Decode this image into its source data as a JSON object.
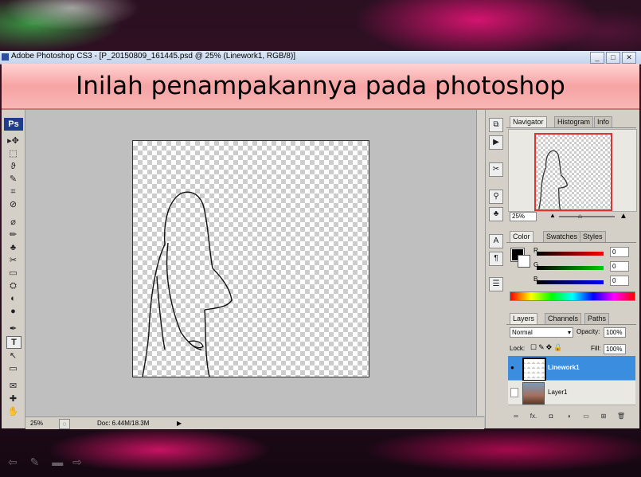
{
  "window": {
    "title": "Adobe Photoshop CS3 - [P_20150809_161445.psd @ 25% (Linework1, RGB/8)]",
    "buttons": [
      "_",
      "□",
      "✕"
    ]
  },
  "banner": {
    "text": "Inilah penampakannya pada photoshop"
  },
  "toolbox": {
    "logo": "Ps",
    "tools": [
      "▸✥",
      "⬚",
      "ϑ",
      "✎",
      "⌗",
      "⊘",
      "⌀",
      "✏",
      "♣",
      "✂",
      "▭",
      "⛭",
      "◐",
      "●",
      "✒",
      "T",
      "↖",
      "▭",
      "✉",
      "✚",
      "✋",
      "🔍"
    ]
  },
  "statusbar": {
    "zoom": "25%",
    "doc": "Doc: 6.44M/18.3M"
  },
  "navigator": {
    "tabs": [
      "Navigator",
      "Histogram",
      "Info"
    ],
    "zoom": "25%"
  },
  "color": {
    "tabs": [
      "Color",
      "Swatches",
      "Styles"
    ],
    "channels": [
      {
        "label": "R",
        "value": "0",
        "color": "#e00000"
      },
      {
        "label": "G",
        "value": "0",
        "color": "#00c000"
      },
      {
        "label": "B",
        "value": "0",
        "color": "#0000e0"
      }
    ]
  },
  "layers": {
    "tabs": [
      "Layers",
      "Channels",
      "Paths"
    ],
    "blend_mode": "Normal",
    "opacity_label": "Opacity:",
    "opacity": "100%",
    "lock_label": "Lock:",
    "fill_label": "Fill:",
    "fill": "100%",
    "items": [
      {
        "name": "Linework1",
        "selected": true
      },
      {
        "name": "Layer1",
        "selected": false
      }
    ],
    "footer_icons": [
      "∞",
      "fx.",
      "◘",
      "◑",
      "▭",
      "⊞",
      "🗑"
    ]
  }
}
